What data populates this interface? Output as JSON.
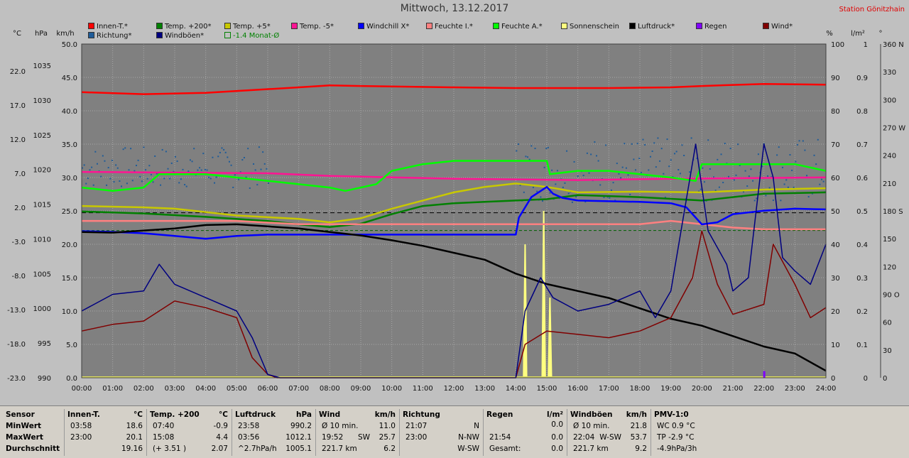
{
  "title": "Mittwoch, 13.12.2017",
  "station": "Station Gönitzhain",
  "units_left": [
    "°C",
    "hPa",
    "km/h"
  ],
  "units_right": [
    "%",
    "l/m²",
    "°"
  ],
  "legend": [
    {
      "label": "Innen-T.*",
      "color": "#ff0000"
    },
    {
      "label": "Temp. +200*",
      "color": "#008000"
    },
    {
      "label": "Temp. +5*",
      "color": "#c8c800"
    },
    {
      "label": "Temp. -5*",
      "color": "#ff1493"
    },
    {
      "label": "Windchill X*",
      "color": "#0000ff"
    },
    {
      "label": "Feuchte I.*",
      "color": "#ff8080"
    },
    {
      "label": "Feuchte A.*",
      "color": "#00ff00"
    },
    {
      "label": "Sonnenschein",
      "color": "#ffff80"
    },
    {
      "label": "Luftdruck*",
      "color": "#000000"
    },
    {
      "label": "Regen",
      "color": "#8000ff"
    },
    {
      "label": "Wind*",
      "color": "#800000"
    },
    {
      "label": "Richtung*",
      "color": "#1f5c99"
    },
    {
      "label": "Windböen*",
      "color": "#000080"
    },
    {
      "label": "-1.4 Monat-Ø",
      "color": "#008000"
    }
  ],
  "chart_data": {
    "type": "line",
    "x_labels": [
      "00:00",
      "01:00",
      "02:00",
      "03:00",
      "04:00",
      "05:00",
      "06:00",
      "07:00",
      "08:00",
      "09:00",
      "10:00",
      "11:00",
      "12:00",
      "13:00",
      "14:00",
      "15:00",
      "16:00",
      "17:00",
      "18:00",
      "19:00",
      "20:00",
      "21:00",
      "22:00",
      "23:00",
      "24:00"
    ],
    "axis_temp_c": [
      "22.0",
      "17.0",
      "12.0",
      "7.0",
      "2.0",
      "-3.0",
      "-8.0",
      "-13.0",
      "-18.0",
      "-23.0"
    ],
    "axis_pressure_hpa": [
      "1035",
      "1030",
      "1025",
      "1020",
      "1015",
      "1010",
      "1005",
      "1000",
      "995",
      "990"
    ],
    "axis_wind_kmh": [
      "50.0",
      "45.0",
      "40.0",
      "35.0",
      "30.0",
      "25.0",
      "20.0",
      "15.0",
      "10.0",
      "5.0",
      "0.0"
    ],
    "axis_humidity_pct": [
      "100",
      "90",
      "80",
      "70",
      "60",
      "50",
      "40",
      "30",
      "20",
      "10",
      "0"
    ],
    "axis_rain_lm2": [
      "1",
      "0.9",
      "0.8",
      "0.7",
      "0.6",
      "0.5",
      "0.4",
      "0.3",
      "0.2",
      "0.1",
      "0"
    ],
    "axis_direction_deg": [
      "360 N",
      "330",
      "300",
      "270 W",
      "240",
      "210",
      "180 S",
      "150",
      "120",
      "90 O",
      "60",
      "30",
      "0"
    ],
    "month_avg_temp": -1.4,
    "series": [
      {
        "name": "Innen-T.*",
        "axis": "temp",
        "color": "#ff0000",
        "points": [
          [
            0,
            18.9
          ],
          [
            2,
            18.6
          ],
          [
            4,
            18.8
          ],
          [
            7,
            19.6
          ],
          [
            8,
            19.9
          ],
          [
            9,
            19.8
          ],
          [
            12,
            19.6
          ],
          [
            14,
            19.5
          ],
          [
            17,
            19.5
          ],
          [
            19,
            19.6
          ],
          [
            20,
            19.8
          ],
          [
            22,
            20.1
          ],
          [
            24,
            20.0
          ]
        ]
      },
      {
        "name": "Temp. -5*",
        "axis": "temp",
        "color": "#ff1493",
        "points": [
          [
            0,
            7.2
          ],
          [
            6,
            7.0
          ],
          [
            8,
            6.6
          ],
          [
            12,
            6.2
          ],
          [
            16,
            6.0
          ],
          [
            19,
            6.2
          ],
          [
            24,
            6.4
          ]
        ]
      },
      {
        "name": "Feuchte A.*",
        "axis": "hum",
        "color": "#00ff00",
        "points": [
          [
            0,
            57
          ],
          [
            1,
            56
          ],
          [
            2,
            57
          ],
          [
            2.5,
            61
          ],
          [
            4,
            61
          ],
          [
            5,
            60
          ],
          [
            6,
            59
          ],
          [
            7,
            58
          ],
          [
            8,
            57
          ],
          [
            8.5,
            56
          ],
          [
            9.5,
            58
          ],
          [
            10,
            62
          ],
          [
            11,
            64
          ],
          [
            12,
            65
          ],
          [
            13,
            65
          ],
          [
            14,
            65
          ],
          [
            15,
            65
          ],
          [
            15.1,
            61
          ],
          [
            16,
            62
          ],
          [
            17,
            62
          ],
          [
            18,
            61
          ],
          [
            19,
            60
          ],
          [
            19.8,
            59
          ],
          [
            20,
            64
          ],
          [
            21,
            64
          ],
          [
            22,
            64
          ],
          [
            23,
            64
          ],
          [
            24,
            62
          ]
        ]
      },
      {
        "name": "Temp. +5*",
        "axis": "temp",
        "color": "#c8c800",
        "points": [
          [
            0,
            2.2
          ],
          [
            2,
            2.0
          ],
          [
            3,
            1.8
          ],
          [
            5,
            0.8
          ],
          [
            7,
            0.3
          ],
          [
            8,
            -0.2
          ],
          [
            9,
            0.4
          ],
          [
            10,
            1.8
          ],
          [
            11,
            3.0
          ],
          [
            12,
            4.2
          ],
          [
            13,
            5.0
          ],
          [
            14,
            5.5
          ],
          [
            15,
            5.0
          ],
          [
            16,
            4.2
          ],
          [
            18,
            4.3
          ],
          [
            20,
            4.2
          ],
          [
            22,
            4.6
          ],
          [
            24,
            4.8
          ]
        ]
      },
      {
        "name": "Temp. +200*",
        "axis": "temp",
        "color": "#008000",
        "points": [
          [
            0,
            1.4
          ],
          [
            2,
            1.1
          ],
          [
            4,
            0.6
          ],
          [
            6,
            0.0
          ],
          [
            7,
            -0.5
          ],
          [
            8,
            -0.9
          ],
          [
            9,
            -0.4
          ],
          [
            10,
            1.0
          ],
          [
            11,
            2.2
          ],
          [
            12,
            2.6
          ],
          [
            13,
            2.8
          ],
          [
            14,
            3.0
          ],
          [
            15,
            3.2
          ],
          [
            16,
            3.8
          ],
          [
            18,
            3.5
          ],
          [
            20,
            3.0
          ],
          [
            22,
            4.0
          ],
          [
            24,
            4.2
          ]
        ]
      },
      {
        "name": "Feuchte I.*",
        "axis": "hum",
        "color": "#ff8080",
        "points": [
          [
            0,
            47
          ],
          [
            2,
            47
          ],
          [
            5,
            47
          ],
          [
            7,
            46
          ],
          [
            8,
            46
          ],
          [
            10,
            46
          ],
          [
            14,
            46
          ],
          [
            15,
            46
          ],
          [
            17,
            46
          ],
          [
            18,
            46
          ],
          [
            19,
            47
          ],
          [
            20,
            46
          ],
          [
            21,
            45
          ],
          [
            22,
            44.5
          ],
          [
            24,
            44.5
          ]
        ]
      },
      {
        "name": "Windchill X*",
        "axis": "temp",
        "color": "#0000ff",
        "points": [
          [
            0,
            -1.5
          ],
          [
            1,
            -1.6
          ],
          [
            2,
            -1.8
          ],
          [
            3,
            -2.2
          ],
          [
            4,
            -2.6
          ],
          [
            5,
            -2.2
          ],
          [
            6,
            -2.0
          ],
          [
            8,
            -2.0
          ],
          [
            10,
            -2.0
          ],
          [
            12,
            -2.0
          ],
          [
            13.0,
            -2.0
          ],
          [
            14.0,
            -2.0
          ],
          [
            14.1,
            0.5
          ],
          [
            14.5,
            3.5
          ],
          [
            15,
            5.0
          ],
          [
            15.2,
            4.0
          ],
          [
            15.5,
            3.4
          ],
          [
            16,
            3.0
          ],
          [
            17,
            2.9
          ],
          [
            18,
            2.8
          ],
          [
            19,
            2.6
          ],
          [
            19.5,
            2.0
          ],
          [
            20,
            -0.5
          ],
          [
            20.5,
            -0.2
          ],
          [
            21,
            1.0
          ],
          [
            22,
            1.5
          ],
          [
            23,
            1.8
          ],
          [
            24,
            1.7
          ]
        ]
      },
      {
        "name": "Luftdruck*",
        "axis": "hpa",
        "color": "#000000",
        "points": [
          [
            0,
            1011
          ],
          [
            1,
            1010.9
          ],
          [
            3,
            1011.5
          ],
          [
            4,
            1012.0
          ],
          [
            5,
            1012.1
          ],
          [
            6,
            1011.8
          ],
          [
            7,
            1011.5
          ],
          [
            8,
            1011.0
          ],
          [
            9,
            1010.5
          ],
          [
            10,
            1009.8
          ],
          [
            11,
            1009.0
          ],
          [
            12,
            1008.0
          ],
          [
            13,
            1007.0
          ],
          [
            14,
            1005.0
          ],
          [
            15,
            1003.5
          ],
          [
            16,
            1002.5
          ],
          [
            17,
            1001.5
          ],
          [
            18,
            1000.0
          ],
          [
            19,
            998.5
          ],
          [
            20,
            997.5
          ],
          [
            21,
            996.0
          ],
          [
            22,
            994.5
          ],
          [
            23,
            993.5
          ],
          [
            24,
            991.0
          ]
        ]
      },
      {
        "name": "Wind*",
        "axis": "kmh",
        "color": "#800000",
        "points": [
          [
            0,
            7.0
          ],
          [
            1,
            8.0
          ],
          [
            2,
            8.5
          ],
          [
            3,
            11.5
          ],
          [
            4,
            10.5
          ],
          [
            5,
            9.0
          ],
          [
            5.5,
            3.0
          ],
          [
            6,
            0.5
          ],
          [
            6.3,
            0
          ],
          [
            14,
            0
          ],
          [
            14.3,
            5.0
          ],
          [
            15,
            7.0
          ],
          [
            16,
            6.5
          ],
          [
            17,
            6.0
          ],
          [
            18,
            7.0
          ],
          [
            19,
            9.0
          ],
          [
            19.7,
            15.0
          ],
          [
            20,
            22.0
          ],
          [
            20.5,
            14.0
          ],
          [
            21,
            9.5
          ],
          [
            22,
            11.0
          ],
          [
            22.3,
            20.0
          ],
          [
            23,
            14.0
          ],
          [
            23.5,
            9.0
          ],
          [
            24,
            10.5
          ]
        ]
      },
      {
        "name": "Windböen*",
        "axis": "kmh",
        "color": "#000080",
        "points": [
          [
            0,
            10.0
          ],
          [
            1,
            12.5
          ],
          [
            2,
            13.0
          ],
          [
            2.5,
            17.0
          ],
          [
            3,
            14.0
          ],
          [
            4,
            12.0
          ],
          [
            5,
            10.0
          ],
          [
            5.5,
            6.0
          ],
          [
            6,
            0.5
          ],
          [
            6.4,
            0
          ],
          [
            14,
            0
          ],
          [
            14.3,
            10.0
          ],
          [
            14.8,
            15.0
          ],
          [
            15.2,
            12.0
          ],
          [
            16,
            10.0
          ],
          [
            17,
            11.0
          ],
          [
            18,
            13.0
          ],
          [
            18.5,
            9.0
          ],
          [
            19,
            13.0
          ],
          [
            19.8,
            35.0
          ],
          [
            20.2,
            22.0
          ],
          [
            20.8,
            17.0
          ],
          [
            21,
            13.0
          ],
          [
            21.5,
            15.0
          ],
          [
            22,
            35.0
          ],
          [
            22.3,
            30.0
          ],
          [
            22.6,
            18.0
          ],
          [
            23,
            16.0
          ],
          [
            23.5,
            14.0
          ],
          [
            24,
            20.0
          ]
        ]
      }
    ],
    "sunshine_spikes": [
      [
        14.3,
        20
      ],
      [
        14.9,
        25
      ],
      [
        15.1,
        12
      ]
    ],
    "rain_bars": [
      [
        22.0,
        0.02
      ]
    ]
  },
  "stats": {
    "columns": [
      {
        "header": "Sensor",
        "unit": "",
        "rows": [
          [
            "MinWert",
            "",
            ""
          ],
          [
            "MaxWert",
            "",
            ""
          ],
          [
            "Durchschnitt",
            "",
            ""
          ]
        ]
      },
      {
        "header": "Innen-T.",
        "unit": "°C",
        "rows": [
          [
            "03:58",
            "",
            "18.6"
          ],
          [
            "23:00",
            "",
            "20.1"
          ],
          [
            "",
            "",
            "19.16"
          ]
        ]
      },
      {
        "header": "Temp. +200",
        "unit": "°C",
        "rows": [
          [
            "07:40",
            "",
            "-0.9"
          ],
          [
            "15:08",
            "",
            "4.4"
          ],
          [
            "(+ 3.51 )",
            "",
            "2.07"
          ]
        ]
      },
      {
        "header": "Luftdruck",
        "unit": "hPa",
        "rows": [
          [
            "23:58",
            "",
            "990.2"
          ],
          [
            "03:56",
            "",
            "1012.1"
          ],
          [
            "^2.7hPa/h",
            "",
            "1005.1"
          ]
        ]
      },
      {
        "header": "Wind",
        "unit": "km/h",
        "rows": [
          [
            "Ø 10 min.",
            "",
            "11.0"
          ],
          [
            "19:52",
            "SW",
            "25.7"
          ],
          [
            "221.7 km",
            "",
            "6.2"
          ]
        ]
      },
      {
        "header": "Richtung",
        "unit": "",
        "rows": [
          [
            "21:07",
            "",
            "N"
          ],
          [
            "23:00",
            "",
            "N-NW"
          ],
          [
            "",
            "",
            "W-SW"
          ]
        ]
      },
      {
        "header": "Regen",
        "unit": "l/m²",
        "rows": [
          [
            "",
            "",
            ""
          ],
          [
            "21:54",
            "",
            "0.0"
          ],
          [
            "Gesamt:",
            "",
            "0.0"
          ]
        ]
      },
      {
        "header": "Windböen",
        "unit": "km/h",
        "rows": [
          [
            "Ø 10 min.",
            "",
            "21.8"
          ],
          [
            "22:04",
            "W-SW",
            "53.7"
          ],
          [
            "221.7 km",
            "",
            "9.2"
          ]
        ]
      },
      {
        "header": "PMV-1:0",
        "unit": "",
        "rows": [
          [
            "WC 0.9 °C",
            "",
            ""
          ],
          [
            "TP -2.9 °C",
            "",
            ""
          ],
          [
            "-4.9hPa/3h",
            "",
            ""
          ]
        ]
      }
    ],
    "rain_min_value": "0.0"
  }
}
